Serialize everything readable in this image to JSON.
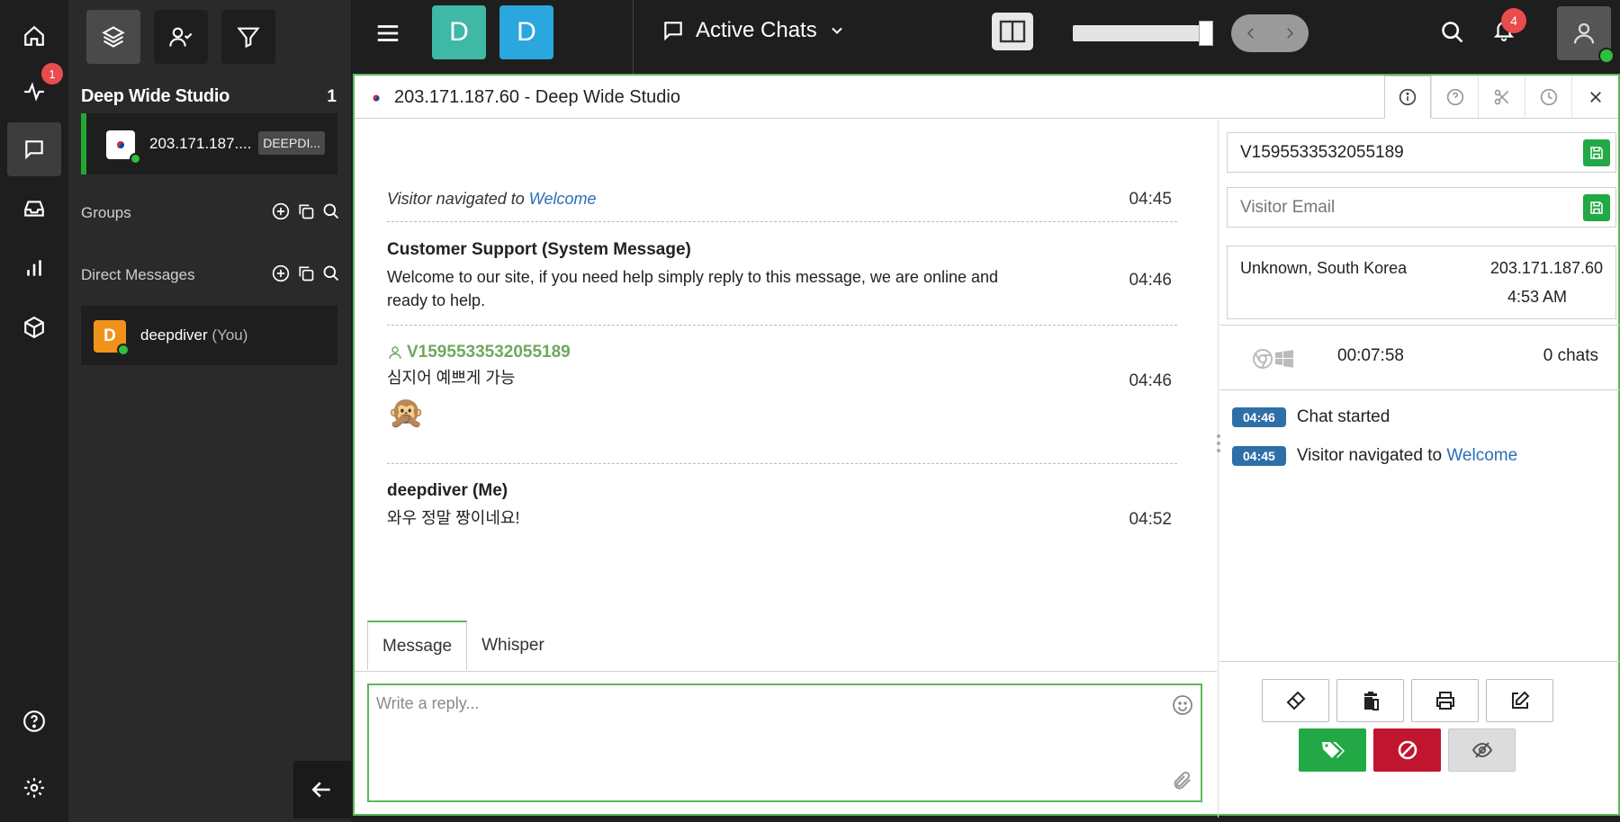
{
  "rail": {
    "pulse_badge": "1",
    "items": [
      "home-icon",
      "pulse-icon",
      "chat-icon",
      "inbox-icon",
      "reports-icon",
      "package-icon",
      "help-icon",
      "gear-icon"
    ]
  },
  "sidebar": {
    "title": "Deep Wide Studio",
    "count": "1",
    "active_chat": {
      "ip": "203.171.187....",
      "tag": "DEEPDI..."
    },
    "groups_label": "Groups",
    "dm_label": "Direct Messages",
    "dm_user": {
      "initial": "D",
      "name": "deepdiver",
      "suffix": "(You)"
    }
  },
  "topbar": {
    "d1": "D",
    "d2": "D",
    "active_chats_label": "Active Chats",
    "notif_count": "4",
    "colors": {
      "d1": "#3fb8a6",
      "d2": "#2aa7df"
    }
  },
  "chat": {
    "title": "203.171.187.60 - Deep Wide Studio",
    "messages": {
      "nav": {
        "prefix": "Visitor navigated to",
        "link": "Welcome",
        "time": "04:45"
      },
      "system": {
        "sender": "Customer Support (System Message)",
        "text": "Welcome to our site, if you need help simply reply to this message, we are online and ready to help.",
        "time": "04:46"
      },
      "visitor": {
        "sender": "V1595533532055189",
        "text": "심지어 예쁘게 가능",
        "emoji": "🙊",
        "time": "04:46"
      },
      "me": {
        "sender": "deepdiver (Me)",
        "text": "와우 정말 짱이네요!",
        "time": "04:52"
      }
    },
    "tabs": {
      "message": "Message",
      "whisper": "Whisper"
    },
    "reply_placeholder": "Write a reply..."
  },
  "panel": {
    "visitor_id": "V1595533532055189",
    "email_placeholder": "Visitor Email",
    "location": "Unknown, South Korea",
    "ip": "203.171.187.60",
    "local_time": "4:53 AM",
    "duration": "00:07:58",
    "chats": "0 chats",
    "timeline": [
      {
        "time": "04:46",
        "text": "Chat started",
        "link": ""
      },
      {
        "time": "04:45",
        "text": "Visitor navigated to",
        "link": "Welcome"
      }
    ]
  }
}
